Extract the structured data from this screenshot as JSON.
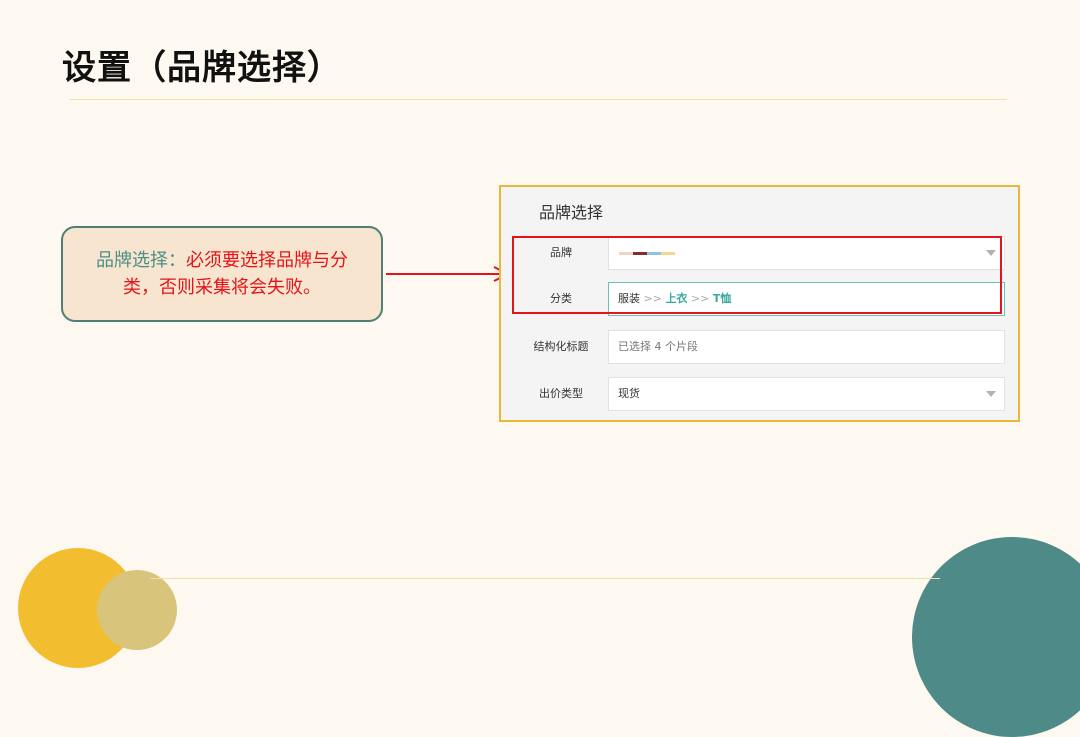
{
  "slide": {
    "title": "设置（品牌选择）"
  },
  "callout": {
    "lead": "品牌选择：",
    "warning": "必须要选择品牌与分类，否则采集将会失败。"
  },
  "panel": {
    "title": "品牌选择",
    "rows": [
      {
        "label": "品牌",
        "value": ""
      },
      {
        "label": "分类",
        "crumbs": [
          "服装",
          "上衣",
          "T恤"
        ],
        "separator": ">>"
      },
      {
        "label": "结构化标题",
        "value": "已选择 4 个片段"
      },
      {
        "label": "出价类型",
        "value": "现货"
      }
    ]
  },
  "colors": {
    "background": "#fdf9f0",
    "accent_teal": "#4e8a88",
    "accent_yellow": "#f2bd2f",
    "highlight_red": "#e5141b",
    "panel_border": "#eab838"
  }
}
